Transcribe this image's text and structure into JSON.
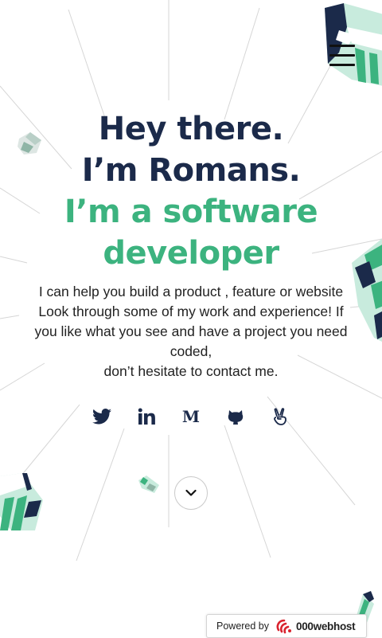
{
  "navigation": {
    "menu_icon": "hamburger-menu-icon"
  },
  "hero": {
    "line1": "Hey there.",
    "line2": "I’m Romans.",
    "line3": "I’m a software",
    "line4": "developer"
  },
  "intro": {
    "lines": [
      "I can help you build a product , feature or website",
      "Look through some of my work and experience! If",
      "you like what you see and have a project you need",
      "coded,",
      "don’t hesitate to contact me."
    ]
  },
  "social": {
    "icons": [
      "twitter-icon",
      "linkedin-icon",
      "medium-icon",
      "github-icon",
      "angellist-icon"
    ],
    "medium_glyph": "M"
  },
  "scroll": {
    "icon": "chevron-down-icon"
  },
  "hosting_badge": {
    "label": "Powered by",
    "brand": "000webhost"
  },
  "colors": {
    "navy": "#1b2a4a",
    "green": "#3cb37f",
    "mint": "#c8ebdd",
    "accent_red": "#d9232e"
  }
}
